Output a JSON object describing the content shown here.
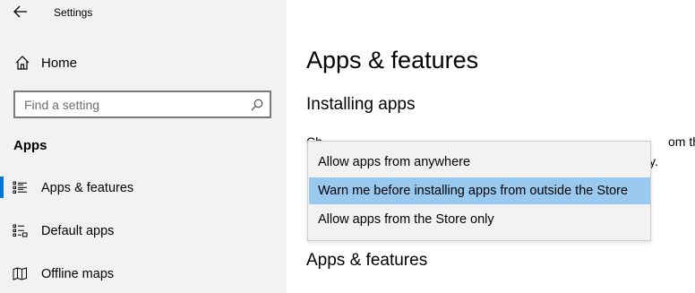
{
  "window": {
    "title": "Settings"
  },
  "sidebar": {
    "home_label": "Home",
    "search_placeholder": "Find a setting",
    "section_label": "Apps",
    "items": [
      {
        "label": "Apps & features",
        "icon": "apps-features-icon",
        "selected": true
      },
      {
        "label": "Default apps",
        "icon": "default-apps-icon",
        "selected": false
      },
      {
        "label": "Offline maps",
        "icon": "offline-maps-icon",
        "selected": false
      }
    ]
  },
  "main": {
    "title": "Apps & features",
    "installing_heading": "Installing apps",
    "description_visible_start": "Ch",
    "description_visible_end": "om the",
    "description_line2_visible": "y.",
    "apps_features_heading": "Apps & features"
  },
  "dropdown": {
    "options": [
      {
        "label": "Allow apps from anywhere",
        "selected": false
      },
      {
        "label": "Warn me before installing apps from outside the Store",
        "selected": true
      },
      {
        "label": "Allow apps from the Store only",
        "selected": false
      }
    ]
  },
  "colors": {
    "accent": "#0078d7",
    "selection": "#99c9ef",
    "sidebar_bg": "#f2f2f2"
  }
}
